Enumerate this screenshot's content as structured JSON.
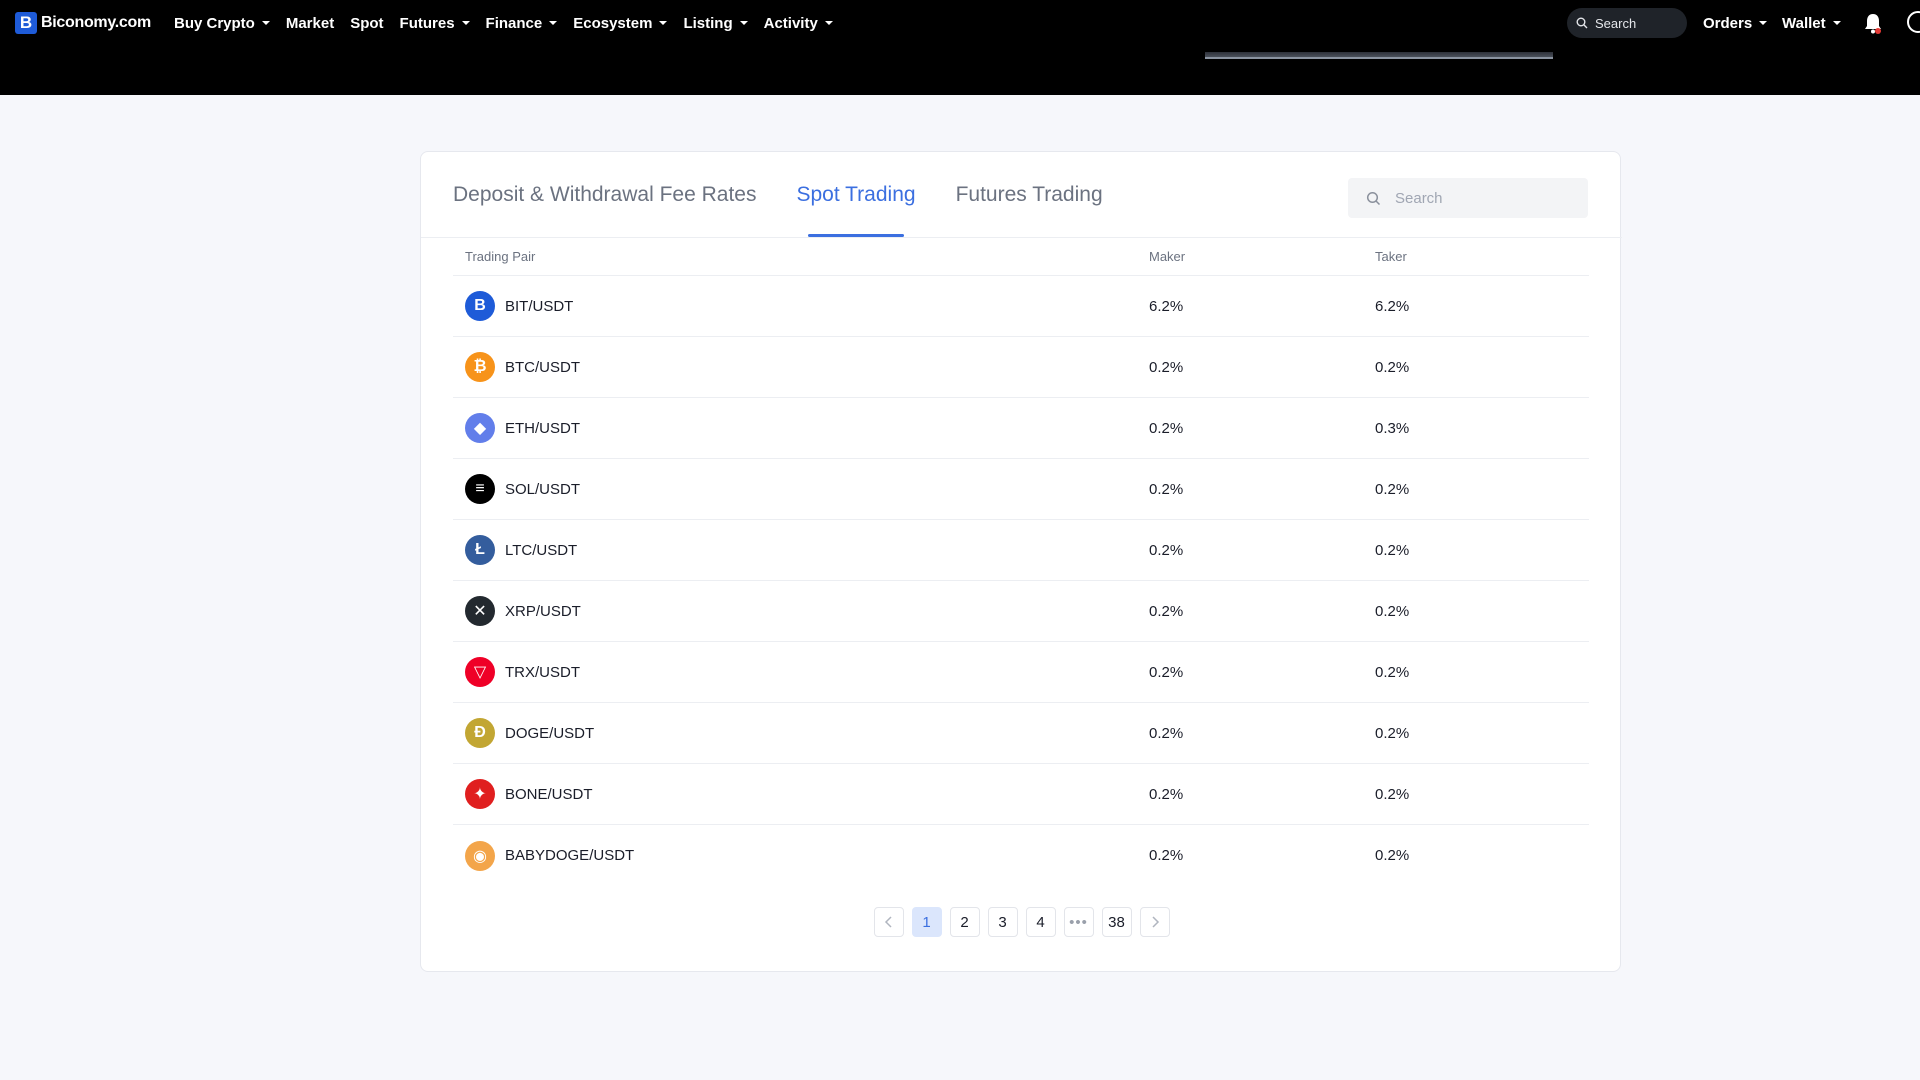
{
  "nav": {
    "brand": "Biconomy.com",
    "brand_letter": "B",
    "menu": [
      {
        "label": "Buy Crypto",
        "caret": true
      },
      {
        "label": "Market",
        "caret": false
      },
      {
        "label": "Spot",
        "caret": false
      },
      {
        "label": "Futures",
        "caret": true
      },
      {
        "label": "Finance",
        "caret": true
      },
      {
        "label": "Ecosystem",
        "caret": true
      },
      {
        "label": "Listing",
        "caret": true
      },
      {
        "label": "Activity",
        "caret": true
      }
    ],
    "search_label": "Search",
    "orders_label": "Orders",
    "wallet_label": "Wallet"
  },
  "tabs": [
    {
      "label": "Deposit & Withdrawal Fee Rates",
      "active": false
    },
    {
      "label": "Spot Trading",
      "active": true
    },
    {
      "label": "Futures Trading",
      "active": false
    }
  ],
  "search": {
    "placeholder": "Search"
  },
  "table": {
    "headers": {
      "pair": "Trading Pair",
      "maker": "Maker",
      "taker": "Taker"
    },
    "rows": [
      {
        "pair": "BIT/USDT",
        "maker": "6.2%",
        "taker": "6.2%",
        "icon": "bit-coin-icon",
        "color": "#1e5bd8",
        "glyph": "B"
      },
      {
        "pair": "BTC/USDT",
        "maker": "0.2%",
        "taker": "0.2%",
        "icon": "bitcoin-icon",
        "color": "#f7931a",
        "glyph": "₿"
      },
      {
        "pair": "ETH/USDT",
        "maker": "0.2%",
        "taker": "0.3%",
        "icon": "ethereum-icon",
        "color": "#627eea",
        "glyph": "◆"
      },
      {
        "pair": "SOL/USDT",
        "maker": "0.2%",
        "taker": "0.2%",
        "icon": "solana-icon",
        "color": "#000000",
        "glyph": "≡"
      },
      {
        "pair": "LTC/USDT",
        "maker": "0.2%",
        "taker": "0.2%",
        "icon": "litecoin-icon",
        "color": "#345d9d",
        "glyph": "Ł"
      },
      {
        "pair": "XRP/USDT",
        "maker": "0.2%",
        "taker": "0.2%",
        "icon": "xrp-icon",
        "color": "#23292f",
        "glyph": "✕"
      },
      {
        "pair": "TRX/USDT",
        "maker": "0.2%",
        "taker": "0.2%",
        "icon": "tron-icon",
        "color": "#ef0027",
        "glyph": "▽"
      },
      {
        "pair": "DOGE/USDT",
        "maker": "0.2%",
        "taker": "0.2%",
        "icon": "dogecoin-icon",
        "color": "#c2a633",
        "glyph": "Ð"
      },
      {
        "pair": "BONE/USDT",
        "maker": "0.2%",
        "taker": "0.2%",
        "icon": "bone-icon",
        "color": "#e01f1f",
        "glyph": "✦"
      },
      {
        "pair": "BABYDOGE/USDT",
        "maker": "0.2%",
        "taker": "0.2%",
        "icon": "babydoge-icon",
        "color": "#f3a54a",
        "glyph": "◉"
      }
    ]
  },
  "pagination": {
    "pages": [
      "1",
      "2",
      "3",
      "4",
      "•••",
      "38"
    ],
    "current": "1"
  },
  "colors": {
    "accent": "#3b6fe0",
    "nav_bg": "#000000",
    "page_bg": "#f6f7fb"
  }
}
